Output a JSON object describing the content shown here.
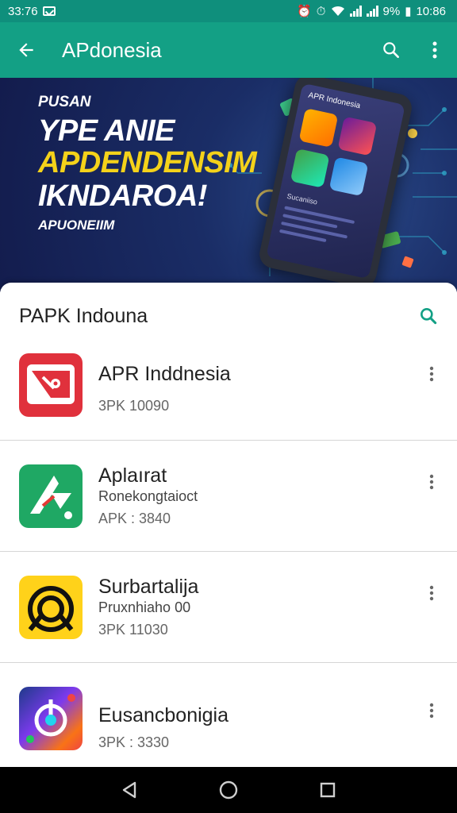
{
  "status_bar": {
    "time_left": "33:76",
    "time_right": "10:86",
    "battery_text": "9%"
  },
  "app_bar": {
    "title": "APdonesia",
    "back_icon": "arrow-left-icon",
    "search_icon": "search-icon",
    "menu_icon": "more-vert-icon"
  },
  "banner": {
    "kicker": "PUSAN",
    "line1": "YPE ANIE",
    "line2": "APDENDENSIM",
    "line3": "IKNDAROA!",
    "subtitle": "APUONEIIM",
    "phone_title": "APR Indonesia",
    "phone_sub": "Sucaniiso",
    "colors": {
      "background": "#131c4d",
      "accent": "#f4d21a"
    }
  },
  "section": {
    "title": "PAPK Indouna",
    "search_icon": "search-icon",
    "accent_color": "#13a085"
  },
  "apps": [
    {
      "name": "APR Inddnesia",
      "developer": "",
      "size": "3PK 10090",
      "icon": "red-app-icon"
    },
    {
      "name": "Aplaırat",
      "developer": "Ronekongtaioct",
      "size": "APK : 3840",
      "icon": "green-app-icon"
    },
    {
      "name": "Surbartalija",
      "developer": "Pruxnhiaho 00",
      "size": "3PK 11030",
      "icon": "yellow-app-icon"
    },
    {
      "name": "Eusancbonigia",
      "developer": "",
      "size": "3PK : 3330",
      "icon": "colorful-app-icon"
    }
  ],
  "nav": {
    "back": "back-triangle-icon",
    "home": "home-circle-icon",
    "recents": "recents-square-icon"
  }
}
